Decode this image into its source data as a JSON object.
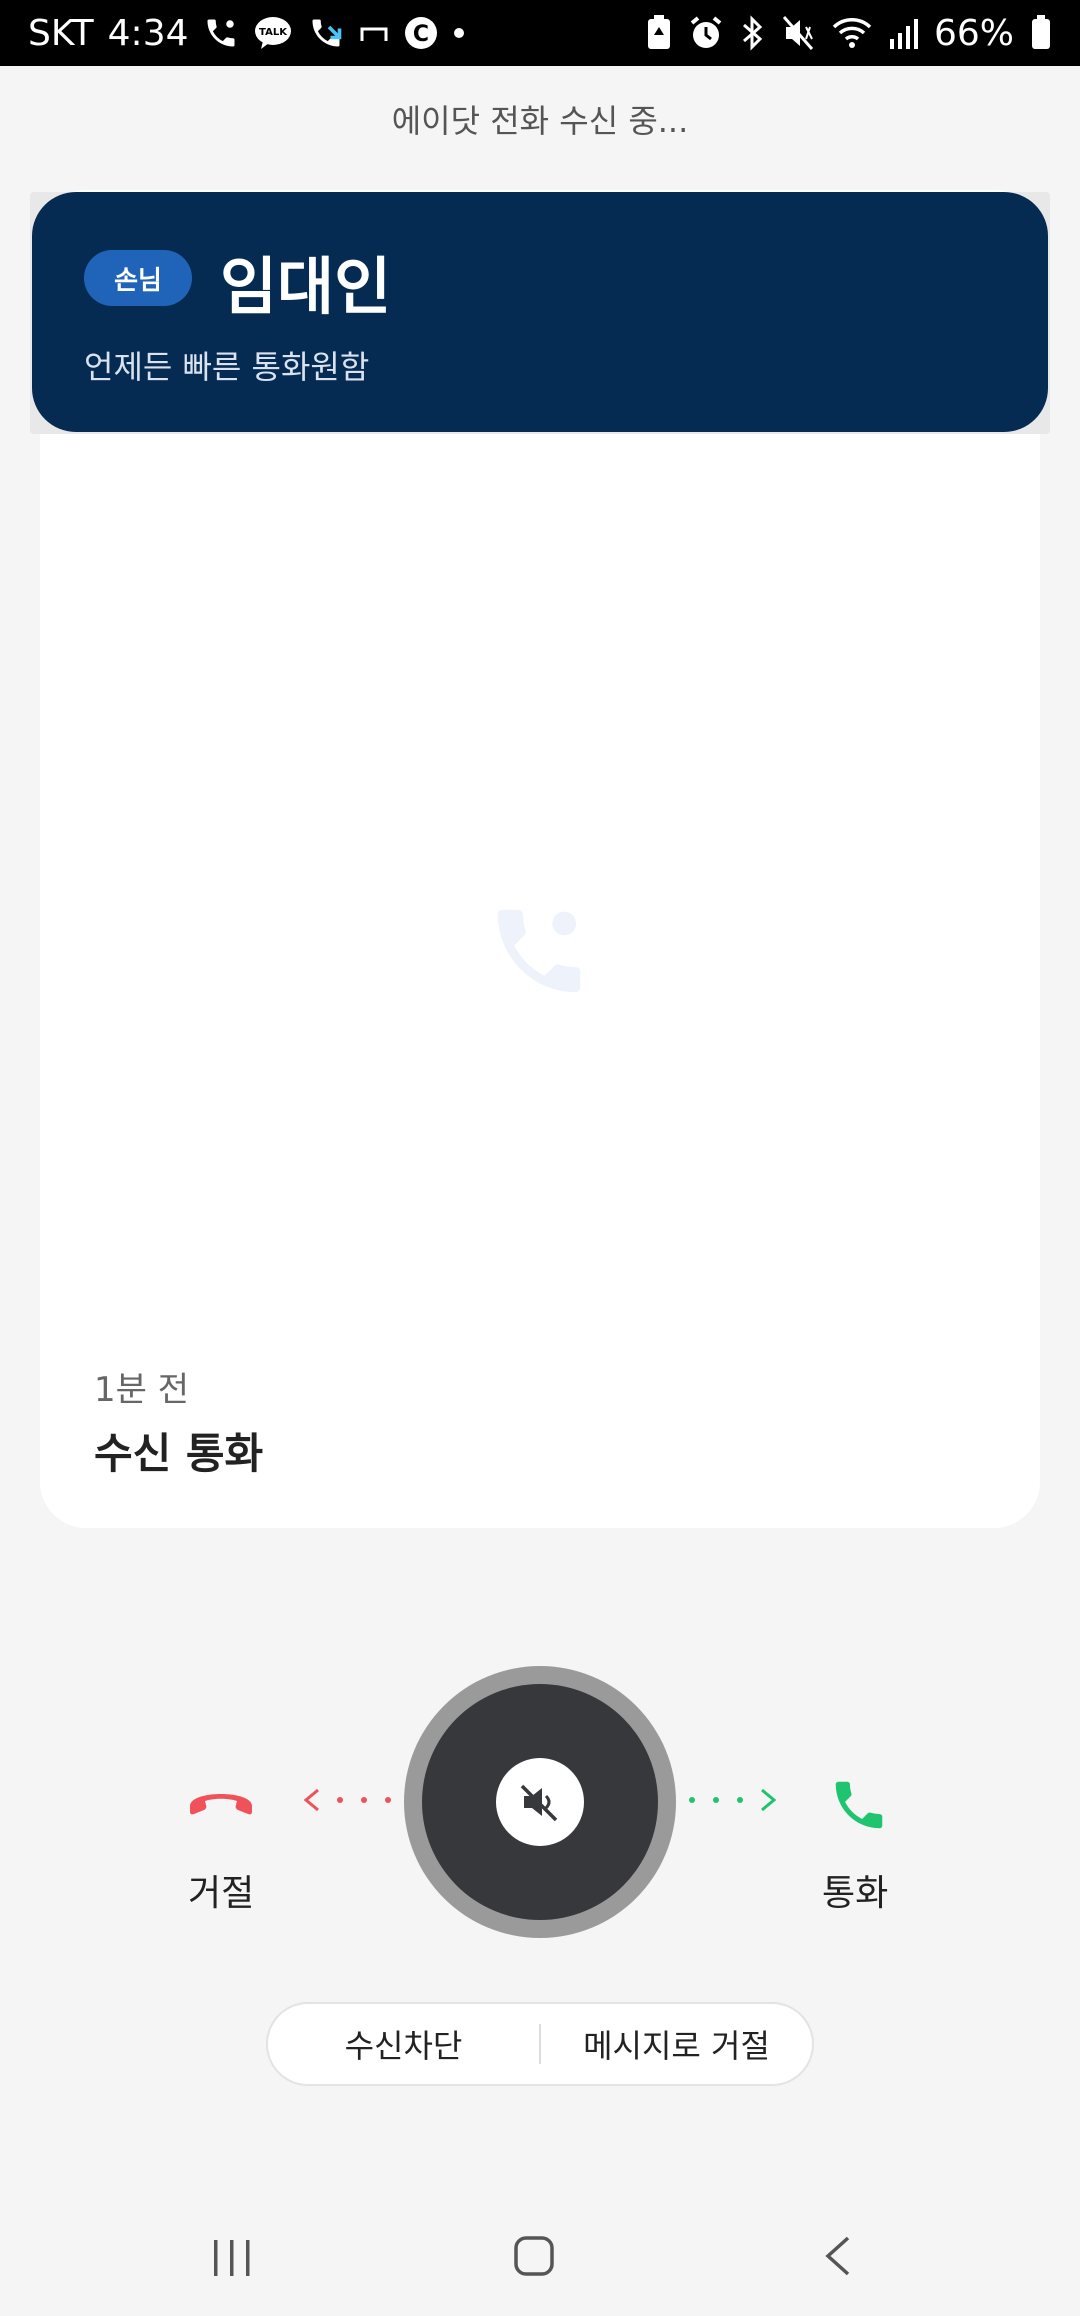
{
  "status_bar": {
    "carrier": "SKT",
    "time": "4:34",
    "battery": "66%",
    "left_icons": [
      "call-icon",
      "kakaotalk-icon",
      "call-forward-icon",
      "nfc-icon",
      "c-icon",
      "dot-icon"
    ],
    "right_icons": [
      "battery-saver-icon",
      "alarm-icon",
      "bluetooth-icon",
      "vibrate-icon",
      "wifi-icon",
      "signal-icon",
      "battery-icon"
    ]
  },
  "ringing_text": "에이닷 전화 수신 중...",
  "caller": {
    "badge": "손님",
    "name": "임대인",
    "memo": "언제든 빠른 통화원함"
  },
  "call_info": {
    "time_ago": "1분 전",
    "type": "수신 통화"
  },
  "controls": {
    "reject_label": "거절",
    "accept_label": "통화",
    "block_label": "수신차단",
    "reject_with_message_label": "메시지로 거절"
  },
  "colors": {
    "header_bg": "#062b53",
    "badge_bg": "#1f64b8",
    "reject": "#f0525a",
    "accept": "#1fc46e",
    "slider": "#37383c"
  }
}
